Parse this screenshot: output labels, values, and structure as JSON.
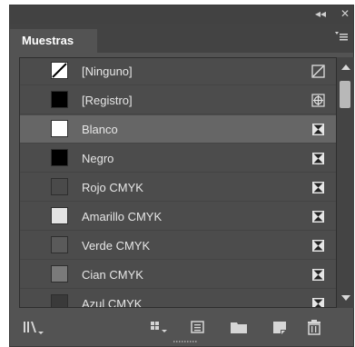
{
  "panel": {
    "collapse_glyph": "◂◂",
    "close_glyph": "✕",
    "tab_label": "Muestras",
    "menu_icon": "panel-menu-icon"
  },
  "swatches": [
    {
      "name": "[Ninguno]",
      "color": "#ffffff",
      "kind": "none",
      "selected": false,
      "tail_icon": "no-edit-icon"
    },
    {
      "name": "[Registro]",
      "color": "#000000",
      "kind": "solid",
      "selected": false,
      "tail_icon": "registration-icon"
    },
    {
      "name": "Blanco",
      "color": "#ffffff",
      "kind": "solid",
      "selected": true,
      "tail_icon": "process-cmyk-icon"
    },
    {
      "name": "Negro",
      "color": "#000000",
      "kind": "solid",
      "selected": false,
      "tail_icon": "process-cmyk-icon"
    },
    {
      "name": "Rojo CMYK",
      "color": "#4a4a4a",
      "kind": "solid",
      "selected": false,
      "tail_icon": "process-cmyk-icon"
    },
    {
      "name": "Amarillo CMYK",
      "color": "#e3e3e3",
      "kind": "solid",
      "selected": false,
      "tail_icon": "process-cmyk-icon"
    },
    {
      "name": "Verde CMYK",
      "color": "#5a5a5a",
      "kind": "solid",
      "selected": false,
      "tail_icon": "process-cmyk-icon"
    },
    {
      "name": "Cian CMYK",
      "color": "#7a7a7a",
      "kind": "solid",
      "selected": false,
      "tail_icon": "process-cmyk-icon"
    },
    {
      "name": "Azul CMYK",
      "color": "#3a3a3a",
      "kind": "solid",
      "selected": false,
      "tail_icon": "process-cmyk-icon"
    }
  ],
  "footer_icons": [
    "swatch-library-icon",
    "show-kinds-icon",
    "swatch-options-icon",
    "new-group-icon",
    "new-swatch-icon",
    "delete-icon"
  ]
}
